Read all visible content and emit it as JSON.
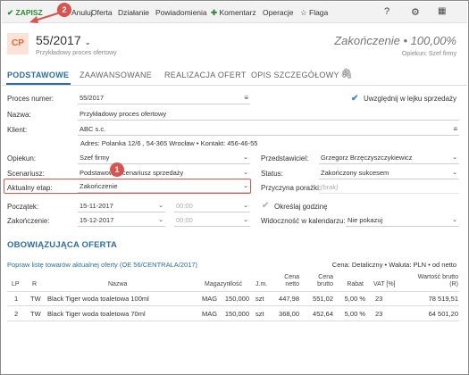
{
  "toolbar": {
    "save": "ZAPISZ",
    "cancel": "Anuluj",
    "offer": "Oferta",
    "action": "Działanie",
    "notifications": "Powiadomienia",
    "comment": "Komentarz",
    "operations": "Operacje",
    "flag": "Flaga"
  },
  "header": {
    "badge": "CP",
    "number": "55/2017",
    "subtitle": "Przykładowy proces ofertowy",
    "stage": "Zakończenie • 100,00%",
    "owner": "Opiekun: Szef firmy"
  },
  "tabs": [
    "PODSTAWOWE",
    "ZAAWANSOWANE",
    "REALIZACJA OFERT",
    "OPIS SZCZEGÓŁOWY"
  ],
  "form": {
    "process_number_label": "Proces numer:",
    "process_number": "55/2017",
    "include_label": "Uwzględnij w lejku sprzedaży",
    "name_label": "Nazwa:",
    "name": "Przykładowy proces ofertowy",
    "client_label": "Klient:",
    "client": "ABC s.c.",
    "address": "Adres: Polanka  12/6 , 54-365 Wrocław  •  Kontakt:  456-46-55",
    "guardian_label": "Opiekun:",
    "guardian": "Szef firmy",
    "scenario_label": "Scenariusz:",
    "scenario": "Podstawowy scenariusz sprzedaży",
    "stage_label": "Aktualny etap:",
    "stage": "Zakończenie",
    "representative_label": "Przedstawiciel:",
    "representative": "Grzegorz Brzęczyszczykiewicz",
    "status_label": "Status:",
    "status": "Zakończony sukcesem",
    "loss_reason_label": "Przyczyna porażki:",
    "loss_reason": "(brak)",
    "start_label": "Początek:",
    "start_date": "15-11-2017",
    "start_time": "00:00",
    "end_label": "Zakończenie:",
    "end_date": "15-12-2017",
    "end_time": "00:00",
    "set_time_label": "Określaj godzinę",
    "calendar_label": "Widoczność w kalendarzu:",
    "calendar": "Nie pokazuj"
  },
  "offer": {
    "title": "OBOWIĄZUJĄCA OFERTA",
    "link": "Popraw listę towarów aktualnej oferty (OE 56/CENTRALA/2017)",
    "meta": "Cena: Detaliczny • Waluta: PLN • od netto",
    "columns": [
      "LP",
      "R",
      "Nazwa",
      "Magazyn",
      "Ilość",
      "J.m.",
      "Cena netto",
      "Cena brutto",
      "Rabat",
      "VAT [%]",
      "Wartość brutto (R)"
    ],
    "rows": [
      [
        "1",
        "TW",
        "Black Tiger woda toaletowa 100ml",
        "MAG",
        "150,000",
        "szt",
        "447,98",
        "551,02",
        "5,00 %",
        "23",
        "78 519,51"
      ],
      [
        "2",
        "TW",
        "Black Tiger woda toaletowa 70ml",
        "MAG",
        "150,000",
        "szt",
        "368,00",
        "452,64",
        "5,00 %",
        "23",
        "64 501,20"
      ]
    ]
  },
  "badges": [
    "1",
    "2"
  ],
  "icons": [
    "check-icon",
    "plus-icon",
    "star-icon",
    "help-icon",
    "gear-icon",
    "grid-icon",
    "chevron-down-icon",
    "menu-icon",
    "paperclip-icon",
    "calendar-icon",
    "arrow-icon"
  ],
  "colors": {
    "accent": "#2a6ea8",
    "save": "#2e8b2e",
    "highlight": "#d9534f",
    "badge_bg": "#fbe3d7",
    "badge_fg": "#e26a2c"
  }
}
